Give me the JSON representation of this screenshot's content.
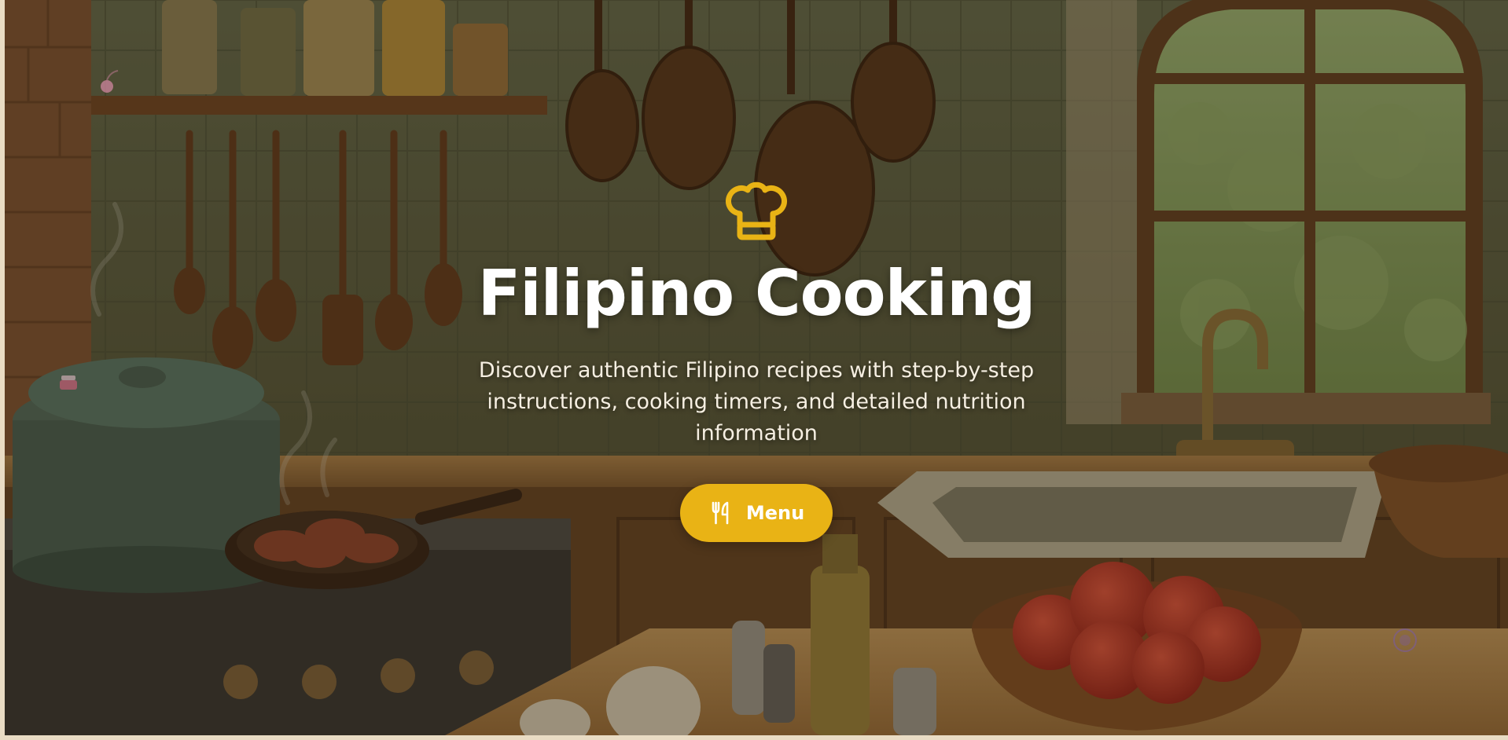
{
  "hero": {
    "icon": "chef-hat-icon",
    "title": "Filipino Cooking",
    "subtitle": "Discover authentic Filipino recipes with step-by-step instructions, cooking timers, and detailed nutrition information",
    "menu_button": {
      "label": "Menu",
      "icon": "utensils-icon"
    }
  },
  "colors": {
    "accent": "#e9b315",
    "title": "#ffffff",
    "page_background": "#e9dcc4"
  },
  "decorations": {
    "background_image": "kitchen-illustration",
    "floating_icons": [
      "cherry-icon",
      "cake-icon",
      "circle-icon"
    ]
  }
}
